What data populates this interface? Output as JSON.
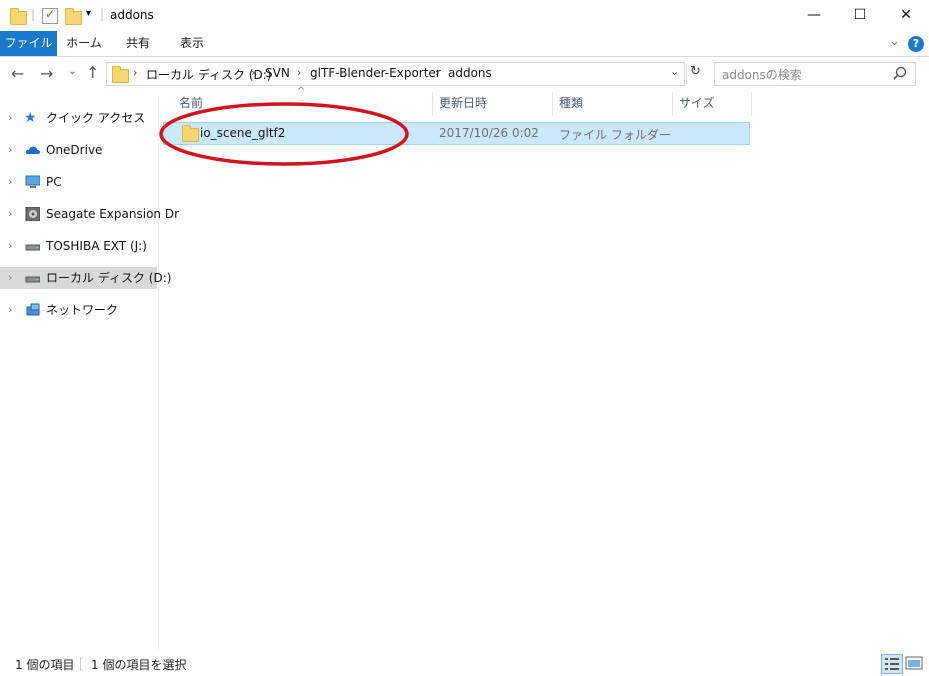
{
  "window": {
    "title": "addons",
    "min_glyph": "—",
    "max_glyph": "☐",
    "close_glyph": "✕"
  },
  "ribbon": {
    "tabs": [
      "ファイル",
      "ホーム",
      "共有",
      "表示"
    ],
    "expand_glyph": "⌄",
    "help_glyph": "?"
  },
  "address": {
    "crumbs": [
      "ローカル ディスク (D:)",
      "SVN",
      "glTF-Blender-Exporter",
      "addons"
    ],
    "search_placeholder": "addonsの検索"
  },
  "sidebar": {
    "items": [
      {
        "label": "クイック アクセス",
        "icon": "star-icon"
      },
      {
        "label": "OneDrive",
        "icon": "cloud-icon"
      },
      {
        "label": "PC",
        "icon": "computer-icon"
      },
      {
        "label": "Seagate Expansion Dr",
        "icon": "external-drive-icon"
      },
      {
        "label": "TOSHIBA EXT (J:)",
        "icon": "drive-icon"
      },
      {
        "label": "ローカル ディスク (D:)",
        "icon": "drive-icon",
        "selected": true
      },
      {
        "label": "ネットワーク",
        "icon": "network-icon"
      }
    ]
  },
  "columns": {
    "name": "名前",
    "date": "更新日時",
    "type": "種類",
    "size": "サイズ"
  },
  "files": [
    {
      "name": "io_scene_gltf2",
      "date": "2017/10/26 0:02",
      "type": "ファイル フォルダー",
      "size": ""
    }
  ],
  "status": {
    "count": "1 個の項目",
    "selected": "1 個の項目を選択"
  },
  "colors": {
    "accent": "#1979ca",
    "selection": "#cce8ff",
    "highlight_ellipse": "#d4141c"
  }
}
